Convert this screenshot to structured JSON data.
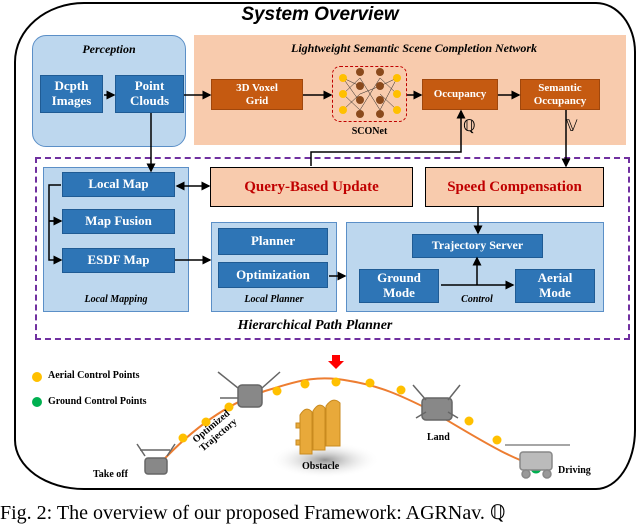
{
  "title": "System Overview",
  "perception": {
    "label": "Perception",
    "depth_images": "Dcpth Images",
    "point_clouds": "Point Clouds"
  },
  "ssc": {
    "label": "Lightweight Semantic Scene Completion Network",
    "voxel_grid": "3D Voxel Grid",
    "network_name": "SCONet",
    "occupancy": "Occupancy",
    "semantic_occupancy": "Semantic Occupancy",
    "q_symbol": "ℚ",
    "v_symbol": "𝕍"
  },
  "planner": {
    "label": "Hierarchical Path Planner",
    "query_update": "Query-Based Update",
    "speed_compensation": "Speed Compensation",
    "local_mapping": {
      "label": "Local Mapping",
      "local_map": "Local Map",
      "map_fusion": "Map Fusion",
      "esdf_map": "ESDF Map"
    },
    "local_planner": {
      "label": "Local Planner",
      "planner": "Planner",
      "optimization": "Optimization"
    },
    "control": {
      "label": "Control",
      "trajectory_server": "Trajectory Server",
      "ground_mode": "Ground Mode",
      "aerial_mode": "Aerial Mode"
    }
  },
  "scene": {
    "legend": {
      "aerial": "Aerial Control Points",
      "ground": "Ground Control Points"
    },
    "take_off": "Take off",
    "trajectory": "Optimized Trajectory",
    "obstacle": "Obstacle",
    "land": "Land",
    "driving": "Driving",
    "colors": {
      "aerial_point": "#ffc000",
      "ground_point": "#00b050",
      "trajectory": "#ed7d31",
      "marker": "#ff0000"
    }
  },
  "caption": "Fig. 2: The overview of our proposed Framework: AGRNav. ℚ"
}
